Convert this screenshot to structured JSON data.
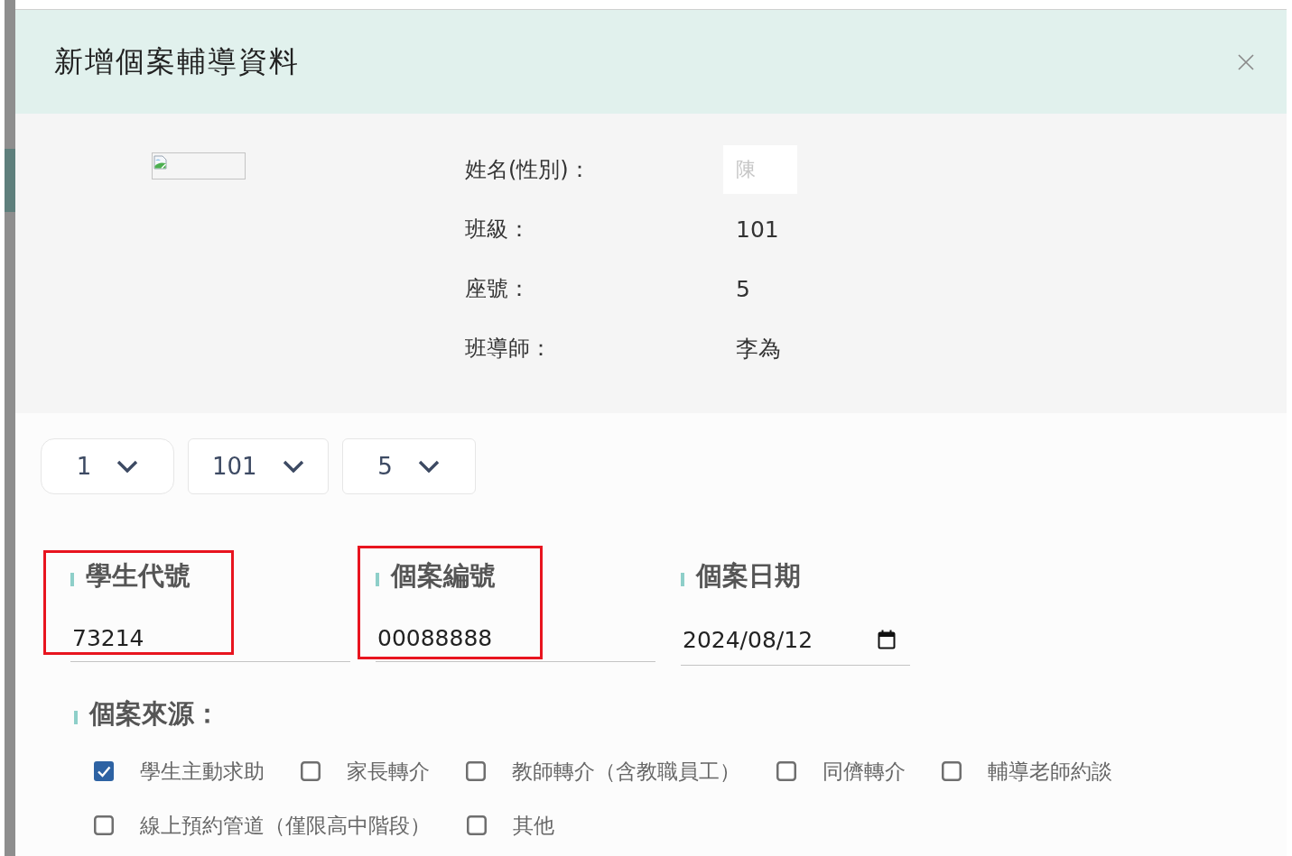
{
  "dialog": {
    "title": "新增個案輔導資料",
    "student_info": [
      {
        "label": "姓名(性別)：",
        "value": "陳",
        "redacted": true
      },
      {
        "label": "班級：",
        "value": "101",
        "redacted": false
      },
      {
        "label": "座號：",
        "value": "5",
        "redacted": false
      },
      {
        "label": "班導師：",
        "value": "李為",
        "redacted": false
      }
    ],
    "selects": [
      {
        "value": "1"
      },
      {
        "value": "101"
      },
      {
        "value": "5"
      }
    ],
    "inputs": [
      {
        "label": "學生代號",
        "value": "73214",
        "kind": "text",
        "highlighted": true
      },
      {
        "label": "個案編號",
        "value": "00088888",
        "kind": "text",
        "highlighted": true
      },
      {
        "label": "個案日期",
        "value": "2024/08/12",
        "kind": "date",
        "highlighted": false
      }
    ],
    "case_source": {
      "label": "個案來源：",
      "options": [
        {
          "label": "學生主動求助",
          "checked": true
        },
        {
          "label": "家長轉介",
          "checked": false
        },
        {
          "label": "教師轉介（含教職員工）",
          "checked": false
        },
        {
          "label": "同儕轉介",
          "checked": false
        },
        {
          "label": "輔導老師約談",
          "checked": false
        },
        {
          "label": "線上預約管道（僅限高中階段）",
          "checked": false
        },
        {
          "label": "其他",
          "checked": false
        }
      ]
    }
  }
}
